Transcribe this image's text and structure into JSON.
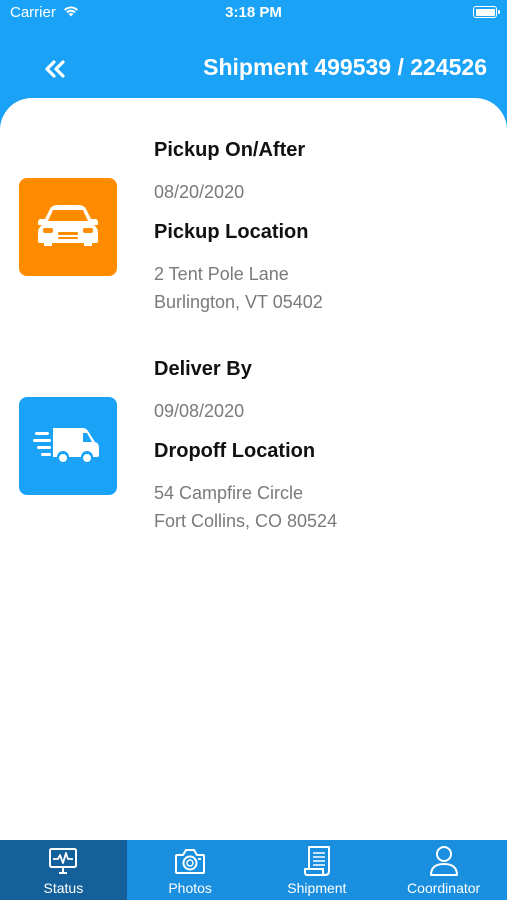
{
  "status_bar": {
    "carrier": "Carrier",
    "time": "3:18 PM",
    "icons": [
      "wifi-icon",
      "battery-icon"
    ]
  },
  "header": {
    "back_icon": "double-chevron-left-icon",
    "title": "Shipment 499539 / 224526",
    "background_color": "#1AA3F6"
  },
  "pickup": {
    "icon": "car-icon",
    "tile_color": "#FF8C00",
    "date_label": "Pickup On/After",
    "date_value": "08/20/2020",
    "location_label": "Pickup Location",
    "address_line1": "2 Tent  Pole Lane",
    "address_line2": "Burlington, VT 05402"
  },
  "delivery": {
    "icon": "delivery-van-icon",
    "tile_color": "#1AA3F6",
    "date_label": "Deliver By",
    "date_value": "09/08/2020",
    "location_label": "Dropoff Location",
    "address_line1": "54 Campfire Circle",
    "address_line2": "Fort Collins, CO 80524"
  },
  "tabbar": {
    "background_color": "#1A8FE0",
    "active_color": "#14609B",
    "tabs": [
      {
        "label": "Status",
        "icon": "monitor-pulse-icon",
        "active": true
      },
      {
        "label": "Photos",
        "icon": "camera-icon",
        "active": false
      },
      {
        "label": "Shipment",
        "icon": "document-list-icon",
        "active": false
      },
      {
        "label": "Coordinator",
        "icon": "person-icon",
        "active": false
      }
    ]
  }
}
